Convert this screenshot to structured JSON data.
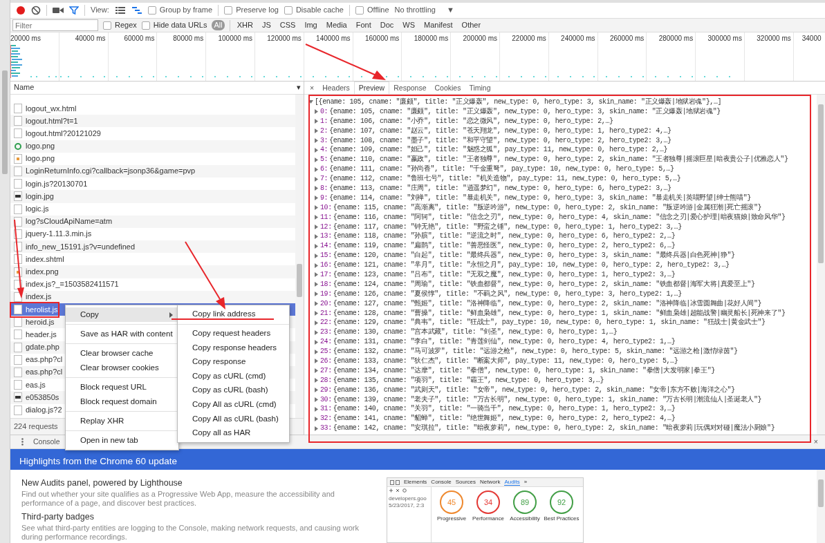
{
  "toolbar": {
    "recording": true,
    "filter_active": true,
    "view_label": "View:",
    "view_buttons": [
      {
        "kind": "list",
        "selected": false
      },
      {
        "kind": "waterfall",
        "selected": true
      }
    ],
    "checkboxes": [
      {
        "label": "Group by frame",
        "checked": false
      },
      {
        "label": "Preserve log",
        "checked": false
      },
      {
        "label": "Disable cache",
        "checked": false
      },
      {
        "label": "Offline",
        "checked": false
      }
    ],
    "throttling": "No throttling",
    "throttle_caret": "▼"
  },
  "filter_bar": {
    "placeholder": "Filter",
    "checkboxes": [
      {
        "label": "Regex",
        "checked": false
      },
      {
        "label": "Hide data URLs",
        "checked": false
      }
    ],
    "types": [
      {
        "label": "All",
        "selected": true
      },
      {
        "label": "XHR",
        "selected": false
      },
      {
        "label": "JS",
        "selected": false
      },
      {
        "label": "CSS",
        "selected": false
      },
      {
        "label": "Img",
        "selected": false
      },
      {
        "label": "Media",
        "selected": false
      },
      {
        "label": "Font",
        "selected": false
      },
      {
        "label": "Doc",
        "selected": false
      },
      {
        "label": "WS",
        "selected": false
      },
      {
        "label": "Manifest",
        "selected": false
      },
      {
        "label": "Other",
        "selected": false
      }
    ]
  },
  "timeline": {
    "ticks": [
      "20000 ms",
      "40000 ms",
      "60000 ms",
      "80000 ms",
      "100000 ms",
      "120000 ms",
      "140000 ms",
      "160000 ms",
      "180000 ms",
      "200000 ms",
      "220000 ms",
      "240000 ms",
      "260000 ms",
      "280000 ms",
      "300000 ms",
      "320000 ms",
      "34000"
    ]
  },
  "requests": {
    "column": "Name",
    "sort_caret": "▾",
    "rows": [
      {
        "name": "logout_wx.html",
        "kind": "doc",
        "selected": false
      },
      {
        "name": "logout.html?t=1",
        "kind": "doc",
        "selected": false
      },
      {
        "name": "logout.html?20121029",
        "kind": "doc",
        "selected": false
      },
      {
        "name": "logo.png",
        "kind": "ring",
        "selected": false
      },
      {
        "name": "logo.png",
        "kind": "image",
        "selected": false
      },
      {
        "name": "LoginReturnInfo.cgi?callback=jsonp36&game=pvp",
        "kind": "doc",
        "selected": false
      },
      {
        "name": "login.js?20130701",
        "kind": "doc",
        "selected": false
      },
      {
        "name": "login.jpg",
        "kind": "photo",
        "selected": false
      },
      {
        "name": "logic.js",
        "kind": "doc",
        "selected": false
      },
      {
        "name": "log?sCloudApiName=atm",
        "kind": "doc",
        "selected": false
      },
      {
        "name": "jquery-1.11.3.min.js",
        "kind": "doc",
        "selected": false
      },
      {
        "name": "info_new_15191.js?v=undefined",
        "kind": "doc",
        "selected": false
      },
      {
        "name": "index.shtml",
        "kind": "doc",
        "selected": false
      },
      {
        "name": "index.png",
        "kind": "image",
        "selected": false
      },
      {
        "name": "index.js?_=1503582411571",
        "kind": "doc",
        "selected": false
      },
      {
        "name": "index.js",
        "kind": "doc",
        "selected": false
      },
      {
        "name": "herolist.js",
        "kind": "doc",
        "selected": true
      },
      {
        "name": "heroid.js",
        "kind": "doc",
        "selected": false
      },
      {
        "name": "header.js",
        "kind": "doc",
        "selected": false
      },
      {
        "name": "gdate.php",
        "kind": "doc",
        "selected": false
      },
      {
        "name": "eas.php?cl",
        "kind": "doc",
        "selected": false
      },
      {
        "name": "eas.php?cl",
        "kind": "doc",
        "selected": false
      },
      {
        "name": "eas.js",
        "kind": "doc",
        "selected": false
      },
      {
        "name": "e053850s",
        "kind": "photo",
        "selected": false
      },
      {
        "name": "dialog.js?2",
        "kind": "doc",
        "selected": false
      }
    ],
    "summary": "224 requests"
  },
  "context_menu": {
    "groups": [
      [
        {
          "label": "Copy",
          "has_submenu": true,
          "highlighted": true
        }
      ],
      [
        {
          "label": "Save as HAR with content",
          "has_submenu": false,
          "highlighted": false
        }
      ],
      [
        {
          "label": "Clear browser cache",
          "has_submenu": false,
          "highlighted": false
        },
        {
          "label": "Clear browser cookies",
          "has_submenu": false,
          "highlighted": false
        }
      ],
      [
        {
          "label": "Block request URL",
          "has_submenu": false,
          "highlighted": false
        },
        {
          "label": "Block request domain",
          "has_submenu": false,
          "highlighted": false
        }
      ],
      [
        {
          "label": "Replay XHR",
          "has_submenu": false,
          "highlighted": false
        }
      ],
      [
        {
          "label": "Open in new tab",
          "has_submenu": false,
          "highlighted": false
        }
      ]
    ],
    "submenu": [
      [
        "Copy link address"
      ],
      [
        "Copy request headers",
        "Copy response headers",
        "Copy response",
        "Copy as cURL (cmd)",
        "Copy as cURL (bash)",
        "Copy All as cURL (cmd)",
        "Copy All as cURL (bash)",
        "Copy all as HAR"
      ]
    ]
  },
  "preview": {
    "close": "×",
    "tabs": [
      {
        "label": "Headers",
        "selected": false
      },
      {
        "label": "Preview",
        "selected": true
      },
      {
        "label": "Response",
        "selected": false
      },
      {
        "label": "Cookies",
        "selected": false
      },
      {
        "label": "Timing",
        "selected": false
      }
    ],
    "root": {
      "text": "[{ename: 105, cname: \"廉颇\", title: \"正义爆轰\", new_type: 0, hero_type: 3, skin_name: \"正义爆轰|地狱岩魂\"},…]",
      "expanded": true
    },
    "lines": [
      {
        "index": "0:",
        "text": "{ename: 105, cname: \"廉颇\", title: \"正义爆轰\", new_type: 0, hero_type: 3, skin_name: \"正义爆轰|地狱岩魂\"}",
        "expanded": false
      },
      {
        "index": "1:",
        "text": "{ename: 106, cname: \"小乔\", title: \"恋之微风\", new_type: 0, hero_type: 2,…}",
        "expanded": false
      },
      {
        "index": "2:",
        "text": "{ename: 107, cname: \"赵云\", title: \"苍天翔龙\", new_type: 0, hero_type: 1, hero_type2: 4,…}",
        "expanded": false
      },
      {
        "index": "3:",
        "text": "{ename: 108, cname: \"墨子\", title: \"和平守望\", new_type: 0, hero_type: 2, hero_type2: 3,…}",
        "expanded": false
      },
      {
        "index": "4:",
        "text": "{ename: 109, cname: \"妲己\", title: \"魅惑之狐\", pay_type: 11, new_type: 0, hero_type: 2,…}",
        "expanded": false
      },
      {
        "index": "5:",
        "text": "{ename: 110, cname: \"嬴政\", title: \"王者独尊\", new_type: 0, hero_type: 2, skin_name: \"王者独尊|摇滚巨星|暗夜贵公子|优雅恋人\"}",
        "expanded": false
      },
      {
        "index": "6:",
        "text": "{ename: 111, cname: \"孙尚香\", title: \"千金重弩\", pay_type: 10, new_type: 0, hero_type: 5,…}",
        "expanded": false
      },
      {
        "index": "7:",
        "text": "{ename: 112, cname: \"鲁班七号\", title: \"机关造物\", pay_type: 11, new_type: 0, hero_type: 5,…}",
        "expanded": false
      },
      {
        "index": "8:",
        "text": "{ename: 113, cname: \"庄周\", title: \"逍遥梦幻\", new_type: 0, hero_type: 6, hero_type2: 3,…}",
        "expanded": false
      },
      {
        "index": "9:",
        "text": "{ename: 114, cname: \"刘禅\", title: \"暴走机关\", new_type: 0, hero_type: 3, skin_name: \"暴走机关|英喵野望|绅士熊喵\"}",
        "expanded": false
      },
      {
        "index": "10:",
        "text": "{ename: 115, cname: \"高渐离\", title: \"叛逆吟游\", new_type: 0, hero_type: 2, skin_name: \"叛逆吟游|金属狂潮|死亡摇滚\"}",
        "expanded": false
      },
      {
        "index": "11:",
        "text": "{ename: 116, cname: \"阿轲\", title: \"信念之刃\", new_type: 0, hero_type: 4, skin_name: \"信念之刃|爱心护理|暗夜猫娘|致命风华\"}",
        "expanded": false
      },
      {
        "index": "12:",
        "text": "{ename: 117, cname: \"钟无艳\", title: \"野蛮之锤\", new_type: 0, hero_type: 1, hero_type2: 3,…}",
        "expanded": false
      },
      {
        "index": "13:",
        "text": "{ename: 118, cname: \"孙膑\", title: \"逆流之时\", new_type: 0, hero_type: 6, hero_type2: 2,…}",
        "expanded": false
      },
      {
        "index": "14:",
        "text": "{ename: 119, cname: \"扁鹊\", title: \"善恶怪医\", new_type: 0, hero_type: 2, hero_type2: 6,…}",
        "expanded": false
      },
      {
        "index": "15:",
        "text": "{ename: 120, cname: \"白起\", title: \"最终兵器\", new_type: 0, hero_type: 3, skin_name: \"最终兵器|白色死神|狰\"}",
        "expanded": false
      },
      {
        "index": "16:",
        "text": "{ename: 121, cname: \"芈月\", title: \"永恒之月\", pay_type: 10, new_type: 0, hero_type: 2, hero_type2: 3,…}",
        "expanded": false
      },
      {
        "index": "17:",
        "text": "{ename: 123, cname: \"吕布\", title: \"无双之魔\", new_type: 0, hero_type: 1, hero_type2: 3,…}",
        "expanded": false
      },
      {
        "index": "18:",
        "text": "{ename: 124, cname: \"周瑜\", title: \"铁血都督\", new_type: 0, hero_type: 2, skin_name: \"铁血都督|海军大将|真爱至上\"}",
        "expanded": false
      },
      {
        "index": "19:",
        "text": "{ename: 126, cname: \"夏侯惇\", title: \"不羁之风\", new_type: 0, hero_type: 3, hero_type2: 1,…}",
        "expanded": false
      },
      {
        "index": "20:",
        "text": "{ename: 127, cname: \"甄姬\", title: \"洛神降临\", new_type: 0, hero_type: 2, skin_name: \"洛神降临|冰雪圆舞曲|花好人间\"}",
        "expanded": false
      },
      {
        "index": "21:",
        "text": "{ename: 128, cname: \"曹操\", title: \"鲜血枭雄\", new_type: 0, hero_type: 1, skin_name: \"鲜血枭雄|超能战警|幽灵船长|死神来了\"}",
        "expanded": false
      },
      {
        "index": "22:",
        "text": "{ename: 129, cname: \"典韦\", title: \"狂战士\", pay_type: 10, new_type: 0, hero_type: 1, skin_name: \"狂战士|黄金武士\"}",
        "expanded": false
      },
      {
        "index": "23:",
        "text": "{ename: 130, cname: \"宫本武藏\", title: \"剑圣\", new_type: 0, hero_type: 1,…}",
        "expanded": false
      },
      {
        "index": "24:",
        "text": "{ename: 131, cname: \"李白\", title: \"青莲剑仙\", new_type: 0, hero_type: 4, hero_type2: 1,…}",
        "expanded": false
      },
      {
        "index": "25:",
        "text": "{ename: 132, cname: \"马可波罗\", title: \"远游之枪\", new_type: 0, hero_type: 5, skin_name: \"远游之枪|激情绿茵\"}",
        "expanded": false
      },
      {
        "index": "26:",
        "text": "{ename: 133, cname: \"狄仁杰\", title: \"断案大师\", pay_type: 11, new_type: 0, hero_type: 5,…}",
        "expanded": false
      },
      {
        "index": "27:",
        "text": "{ename: 134, cname: \"达摩\", title: \"拳僧\", new_type: 0, hero_type: 1, skin_name: \"拳僧|大发明家|拳王\"}",
        "expanded": false
      },
      {
        "index": "28:",
        "text": "{ename: 135, cname: \"项羽\", title: \"霸王\", new_type: 0, hero_type: 3,…}",
        "expanded": false
      },
      {
        "index": "29:",
        "text": "{ename: 136, cname: \"武则天\", title: \"女帝\", new_type: 0, hero_type: 2, skin_name: \"女帝|东方不败|海洋之心\"}",
        "expanded": false
      },
      {
        "index": "30:",
        "text": "{ename: 139, cname: \"老夫子\", title: \"万古长明\", new_type: 0, hero_type: 1, skin_name: \"万古长明|潮流仙人|圣诞老人\"}",
        "expanded": false
      },
      {
        "index": "31:",
        "text": "{ename: 140, cname: \"关羽\", title: \"一骑当千\", new_type: 0, hero_type: 1, hero_type2: 3,…}",
        "expanded": false
      },
      {
        "index": "32:",
        "text": "{ename: 141, cname: \"貂蝉\", title: \"绝世舞姬\", new_type: 0, hero_type: 2, hero_type2: 4,…}",
        "expanded": false
      },
      {
        "index": "33:",
        "text": "{ename: 142, cname: \"安琪拉\", title: \"暗夜萝莉\", new_type: 0, hero_type: 2, skin_name: \"暗夜萝莉|玩偶对对碰|魔法小厨娘\"}",
        "expanded": false
      }
    ]
  },
  "drawer": {
    "tabs": [
      {
        "label": "Console",
        "selected": false
      }
    ],
    "close": "×",
    "banner": "Highlights from the Chrome 60 update",
    "features": [
      {
        "title": "New Audits panel, powered by Lighthouse",
        "description": "Find out whether your site qualifies as a Progressive Web App, measure the accessibility and performance of a page, and discover best practices."
      },
      {
        "title": "Third-party badges",
        "description": "See what third-party entities are logging to the Console, making network requests, and causing work during performance recordings."
      }
    ],
    "screenshot": {
      "tabs": [
        {
          "label": "Elements",
          "selected": false
        },
        {
          "label": "Console",
          "selected": false
        },
        {
          "label": "Sources",
          "selected": false
        },
        {
          "label": "Network",
          "selected": false
        },
        {
          "label": "Audits",
          "selected": true
        },
        {
          "label": "»",
          "selected": false
        }
      ],
      "site": "developers.goo",
      "date": "5/23/2017, 2:3",
      "gauges": [
        {
          "score": "45",
          "label": "Progressive",
          "color": "#f0892e"
        },
        {
          "score": "34",
          "label": "Performance",
          "color": "#e53935"
        },
        {
          "score": "89",
          "label": "Accessibility",
          "color": "#43a047"
        },
        {
          "score": "92",
          "label": "Best Practices",
          "color": "#43a047"
        }
      ]
    }
  }
}
